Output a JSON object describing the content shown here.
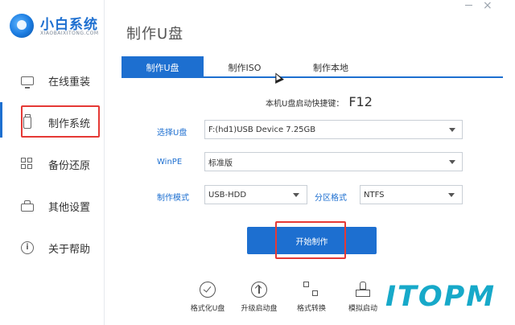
{
  "window": {
    "minimize": "—",
    "close": "×"
  },
  "logo": {
    "title": "小白系统",
    "subtitle": "XIAOBAIXITONG.COM"
  },
  "sidebar": {
    "items": [
      {
        "label": "在线重装",
        "icon": "monitor-icon"
      },
      {
        "label": "制作系统",
        "icon": "usb-icon",
        "active": true
      },
      {
        "label": "备份还原",
        "icon": "grid-icon"
      },
      {
        "label": "其他设置",
        "icon": "toolbox-icon"
      },
      {
        "label": "关于帮助",
        "icon": "info-icon"
      }
    ]
  },
  "header": {
    "title": "制作U盘"
  },
  "tabs": [
    {
      "label": "制作U盘",
      "active": true
    },
    {
      "label": "制作ISO",
      "active": false
    },
    {
      "label": "制作本地",
      "active": false
    }
  ],
  "hotkey": {
    "label": "本机U盘启动快捷键：",
    "key": "F12"
  },
  "form": {
    "select_u_label": "选择U盘",
    "select_u_value": "F:(hd1)USB Device 7.25GB",
    "winpe_label": "WinPE",
    "winpe_value": "标准版",
    "mode_label": "制作模式",
    "mode_value": "USB-HDD",
    "partition_label": "分区格式",
    "partition_value": "NTFS"
  },
  "start_button": {
    "label": "开始制作"
  },
  "tools": [
    {
      "label": "格式化U盘",
      "icon": "check-circle-icon"
    },
    {
      "label": "升级启动盘",
      "icon": "upload-circle-icon"
    },
    {
      "label": "格式转换",
      "icon": "convert-icon"
    },
    {
      "label": "模拟启动",
      "icon": "joystick-icon"
    }
  ],
  "watermark": {
    "text": "ITOPM"
  },
  "colors": {
    "accent": "#1d6fd0",
    "highlight_box": "#e53935",
    "watermark": "#17a9c9"
  }
}
